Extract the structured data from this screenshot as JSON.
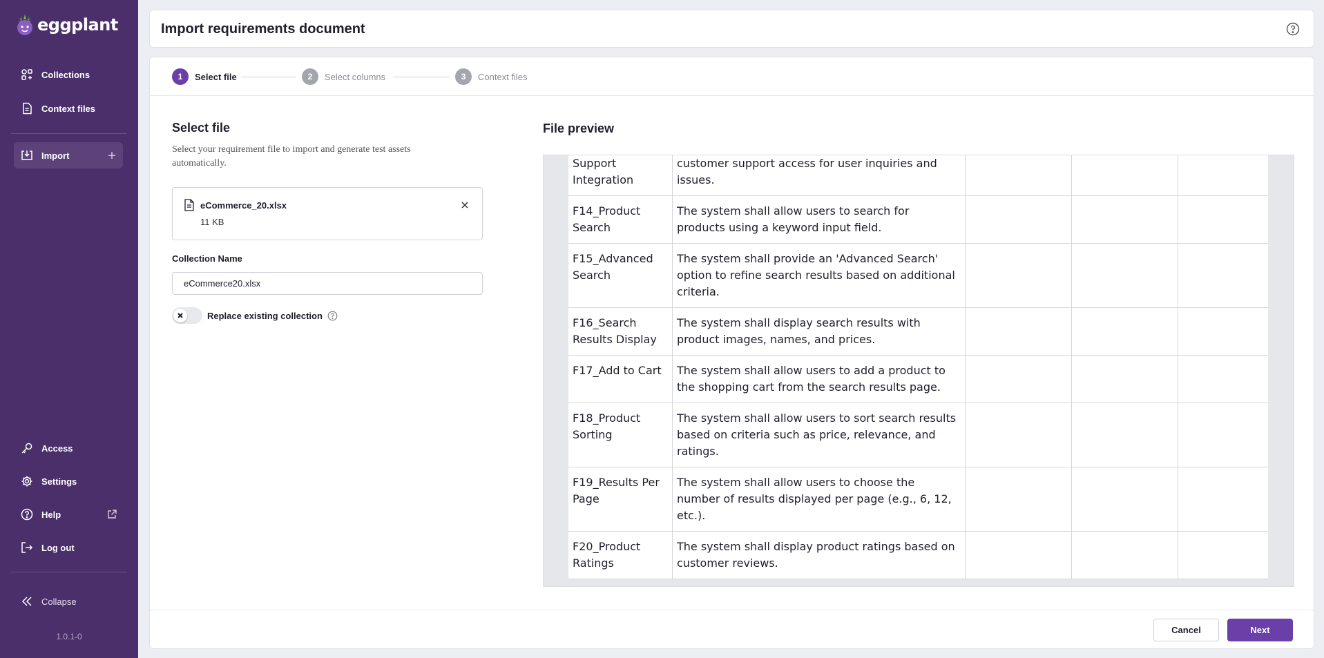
{
  "sidebar": {
    "brand": "eggplant",
    "nav_top": [
      {
        "label": "Collections",
        "icon": "collections-icon"
      },
      {
        "label": "Context files",
        "icon": "document-icon"
      }
    ],
    "import_item": {
      "label": "Import",
      "icon": "import-icon"
    },
    "nav_bottom": [
      {
        "label": "Access",
        "icon": "key-icon"
      },
      {
        "label": "Settings",
        "icon": "gear-icon"
      },
      {
        "label": "Help",
        "icon": "help-icon"
      },
      {
        "label": "Log out",
        "icon": "logout-icon"
      }
    ],
    "collapse_label": "Collapse",
    "version": "1.0.1-0"
  },
  "header": {
    "title": "Import requirements document"
  },
  "stepper": {
    "steps": [
      {
        "num": "1",
        "label": "Select file",
        "state": "active"
      },
      {
        "num": "2",
        "label": "Select columns",
        "state": "inactive"
      },
      {
        "num": "3",
        "label": "Context files",
        "state": "inactive"
      }
    ]
  },
  "select_file": {
    "title": "Select file",
    "description": "Select your requirement file to import and generate test assets automatically.",
    "file_name": "eCommerce_20.xlsx",
    "file_size": "11 KB",
    "collection_label": "Collection Name",
    "collection_value": "eCommerce20.xlsx",
    "toggle_label": "Replace existing collection",
    "toggle_on": false
  },
  "preview": {
    "title": "File preview",
    "rows": [
      {
        "id": "Support Integration",
        "desc": "customer support access for user inquiries and issues.",
        "c3": "",
        "c4": "",
        "c5": ""
      },
      {
        "id": "F14_Product Search",
        "desc": "The system shall allow users to search for products using a keyword input field.",
        "c3": "",
        "c4": "",
        "c5": ""
      },
      {
        "id": "F15_Advanced Search",
        "desc": "The system shall provide an 'Advanced Search' option to refine search results based on additional criteria.",
        "c3": "",
        "c4": "",
        "c5": ""
      },
      {
        "id": "F16_Search Results Display",
        "desc": "The system shall display search results with product images, names, and prices.",
        "c3": "",
        "c4": "",
        "c5": ""
      },
      {
        "id": "F17_Add to Cart",
        "desc": "The system shall allow users to add a product to the shopping cart from the search results page.",
        "c3": "",
        "c4": "",
        "c5": ""
      },
      {
        "id": "F18_Product Sorting",
        "desc": "The system shall allow users to sort search results based on criteria such as price, relevance, and ratings.",
        "c3": "",
        "c4": "",
        "c5": ""
      },
      {
        "id": "F19_Results Per Page",
        "desc": "The system shall allow users to choose the number of results displayed per page (e.g., 6, 12, etc.).",
        "c3": "",
        "c4": "",
        "c5": ""
      },
      {
        "id": "F20_Product Ratings",
        "desc": "The system shall display product ratings based on customer reviews.",
        "c3": "",
        "c4": "",
        "c5": ""
      }
    ]
  },
  "footer": {
    "cancel_label": "Cancel",
    "next_label": "Next"
  },
  "colors": {
    "sidebar": "#4b2f6a",
    "accent": "#6a3fa8",
    "background": "#eceef3"
  }
}
